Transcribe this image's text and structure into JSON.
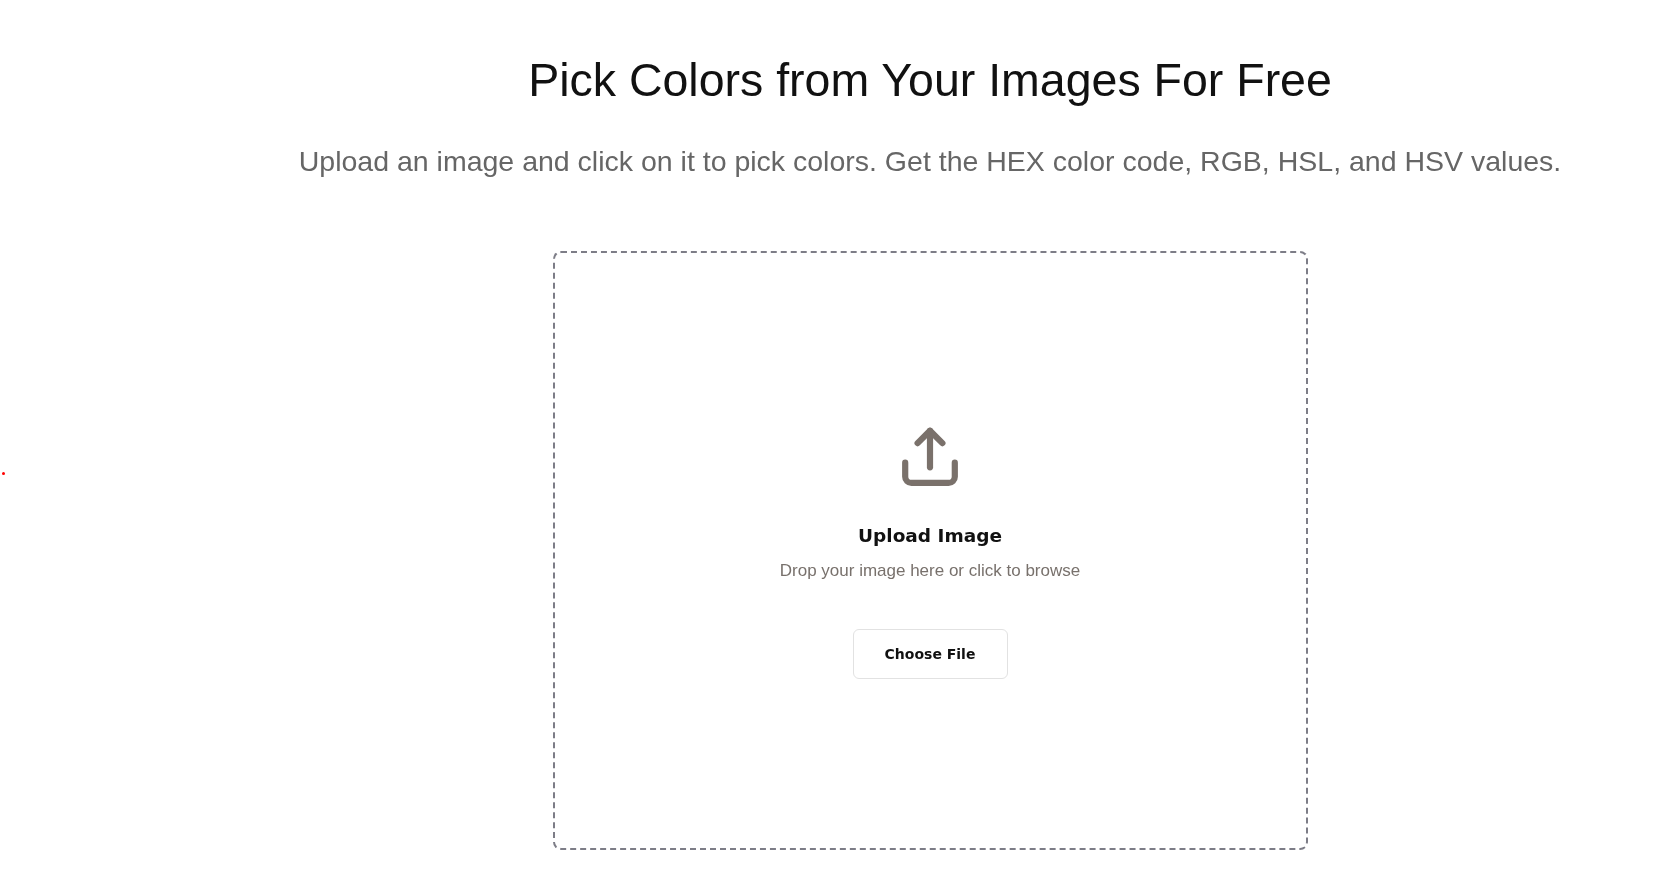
{
  "header": {
    "title": "Pick Colors from Your Images For Free",
    "subtitle": "Upload an image and click on it to pick colors. Get the HEX color code, RGB, HSL, and HSV values."
  },
  "upload_area": {
    "heading": "Upload Image",
    "hint": "Drop your image here or click to browse",
    "button": "Choose File"
  }
}
